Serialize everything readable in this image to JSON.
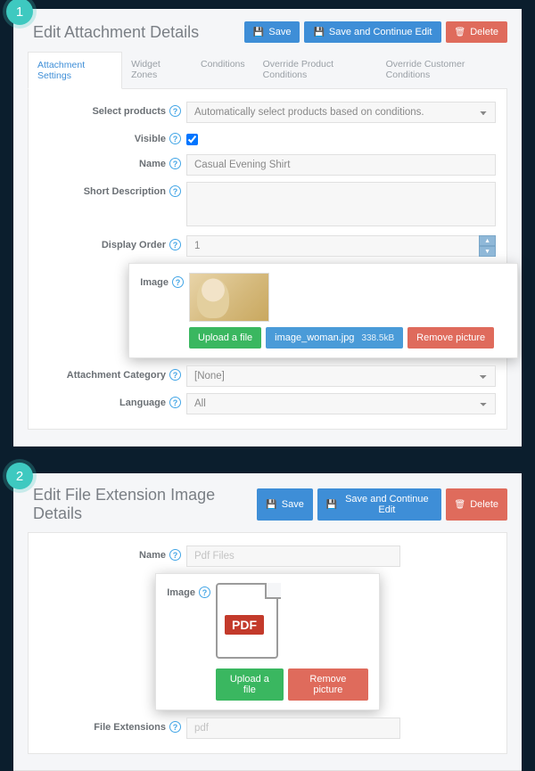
{
  "badges": {
    "one": "1",
    "two": "2"
  },
  "panel1": {
    "title": "Edit Attachment Details",
    "actions": {
      "save": "Save",
      "saveContinue": "Save and Continue Edit",
      "delete": "Delete"
    },
    "tabs": [
      "Attachment Settings",
      "Widget Zones",
      "Conditions",
      "Override Product Conditions",
      "Override Customer Conditions"
    ],
    "fields": {
      "selectProducts": {
        "label": "Select products",
        "value": "Automatically select products based on conditions."
      },
      "visible": {
        "label": "Visible"
      },
      "name": {
        "label": "Name",
        "value": "Casual Evening Shirt"
      },
      "shortDesc": {
        "label": "Short Description"
      },
      "displayOrder": {
        "label": "Display Order",
        "value": "1"
      },
      "image": {
        "label": "Image",
        "upload": "Upload a file",
        "remove": "Remove picture",
        "filename": "image_woman.jpg",
        "filesize": "338.5kB"
      },
      "category": {
        "label": "Attachment Category",
        "value": "[None]"
      },
      "language": {
        "label": "Language",
        "value": "All"
      }
    }
  },
  "panel2": {
    "title": "Edit File Extension Image Details",
    "actions": {
      "save": "Save",
      "saveContinue": "Save and Continue Edit",
      "delete": "Delete"
    },
    "fields": {
      "name": {
        "label": "Name",
        "value": "Pdf Files"
      },
      "image": {
        "label": "Image",
        "upload": "Upload a file",
        "remove": "Remove picture",
        "badge": "PDF"
      },
      "ext": {
        "label": "File Extensions",
        "value": "pdf"
      }
    }
  }
}
